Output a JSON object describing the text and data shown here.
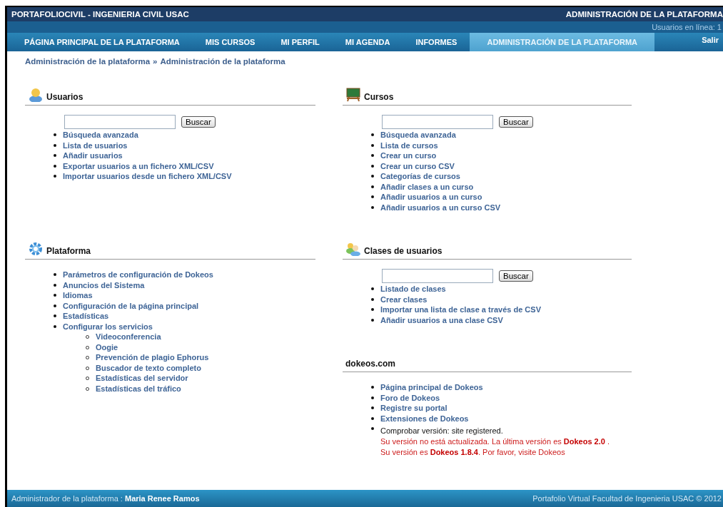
{
  "header": {
    "site_title": "PORTAFOLIOCIVIL - INGENIERIA CIVIL USAC",
    "section_title": "ADMINISTRACIÓN DE LA PLATAFORMA",
    "online_users": "Usuarios en línea: 1"
  },
  "nav": {
    "tabs": [
      {
        "label": "PÁGINA PRINCIPAL DE LA PLATAFORMA",
        "selected": false
      },
      {
        "label": "MIS CURSOS",
        "selected": false
      },
      {
        "label": "MI PERFIL",
        "selected": false
      },
      {
        "label": "MI AGENDA",
        "selected": false
      },
      {
        "label": "INFORMES",
        "selected": false
      },
      {
        "label": "ADMINISTRACIÓN DE LA PLATAFORMA",
        "selected": true
      }
    ],
    "logout": "Salir"
  },
  "breadcrumb": [
    "Administración de la plataforma",
    "»",
    "Administración de la plataforma"
  ],
  "columns": [
    [
      {
        "title": "Usuarios",
        "kind": "user",
        "search_button": "Buscar",
        "items": [
          {
            "kind": "link",
            "text": "Búsqueda avanzada"
          },
          {
            "kind": "link",
            "text": "Lista de usuarios"
          },
          {
            "kind": "link",
            "text": "Añadir usuarios"
          },
          {
            "kind": "link",
            "text": "Exportar usuarios a un fichero XML/CSV"
          },
          {
            "kind": "link",
            "text": "Importar usuarios desde un fichero XML/CSV"
          }
        ]
      },
      {
        "title": "Plataforma",
        "kind": "gear",
        "items": [
          {
            "kind": "link",
            "text": "Parámetros de configuración de Dokeos"
          },
          {
            "kind": "link",
            "text": "Anuncios del Sistema"
          },
          {
            "kind": "link",
            "text": "Idiomas"
          },
          {
            "kind": "link",
            "text": "Configuración de la página principal"
          },
          {
            "kind": "link",
            "text": "Estadísticas"
          },
          {
            "kind": "link",
            "text": "Configurar los servicios",
            "children": [
              {
                "kind": "link",
                "text": "Videoconferencia"
              },
              {
                "kind": "link",
                "text": "Oogie"
              },
              {
                "kind": "link",
                "text": "Prevención de plagio Ephorus"
              },
              {
                "kind": "link",
                "text": "Buscador de texto completo"
              },
              {
                "kind": "link",
                "text": "Estadísticas del servidor"
              },
              {
                "kind": "link",
                "text": "Estadísticas del tráfico"
              }
            ]
          }
        ]
      }
    ],
    [
      {
        "title": "Cursos",
        "kind": "board",
        "search_button": "Buscar",
        "items": [
          {
            "kind": "link",
            "text": "Búsqueda avanzada"
          },
          {
            "kind": "link",
            "text": "Lista de cursos"
          },
          {
            "kind": "link",
            "text": "Crear un curso"
          },
          {
            "kind": "link",
            "text": "Crear un curso CSV"
          },
          {
            "kind": "link",
            "text": "Categorías de cursos"
          },
          {
            "kind": "link",
            "text": "Añadir clases a un curso"
          },
          {
            "kind": "link",
            "text": "Añadir usuarios a un curso"
          },
          {
            "kind": "link",
            "text": "Añadir usuarios a un curso CSV"
          }
        ]
      },
      {
        "title": "Clases de usuarios",
        "kind": "users",
        "search_button": "Buscar",
        "items": [
          {
            "kind": "link",
            "text": "Listado de clases"
          },
          {
            "kind": "link",
            "text": "Crear clases"
          },
          {
            "kind": "link",
            "text": "Importar una lista de clase a través de CSV"
          },
          {
            "kind": "link",
            "text": "Añadir usuarios a una clase CSV"
          }
        ]
      },
      {
        "title": "dokeos.com",
        "items": [
          {
            "kind": "link",
            "text": "Página principal de Dokeos"
          },
          {
            "kind": "link",
            "text": "Foro de Dokeos"
          },
          {
            "kind": "link",
            "text": "Registre su portal"
          },
          {
            "kind": "link",
            "text": "Extensiones de Dokeos"
          },
          {
            "kind": "note",
            "text": "Comprobar versión: site registered.",
            "warnings": [
              "Su versión no está actualizada. La última versión es **Dokeos 2.0** .",
              "Su versión es **Dokeos 1.8.4**. Por favor, visite Dokeos"
            ]
          }
        ]
      }
    ]
  ],
  "footer": {
    "admin_label": "Administrador de la plataforma :",
    "admin_name": "Maria Renee Ramos",
    "copyright": "Portafolio Virtual Facultad de Ingenieria USAC © 2012"
  }
}
